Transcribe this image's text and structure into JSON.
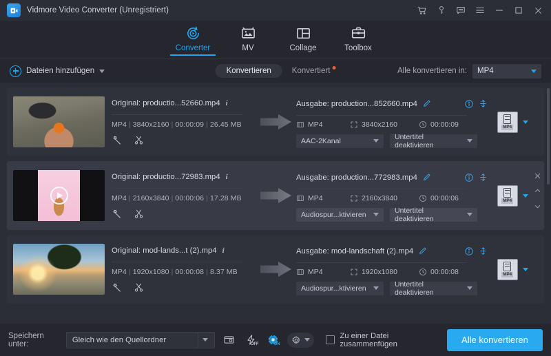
{
  "window": {
    "title": "Vidmore Video Converter (Unregistriert)",
    "controls": [
      {
        "name": "cart-icon",
        "glyph": "cart"
      },
      {
        "name": "key-icon",
        "glyph": "key"
      },
      {
        "name": "feedback-icon",
        "glyph": "message"
      },
      {
        "name": "menu-icon",
        "glyph": "hamburger"
      },
      {
        "name": "minimize-icon",
        "glyph": "minimize"
      },
      {
        "name": "maximize-icon",
        "glyph": "maximize"
      },
      {
        "name": "close-icon",
        "glyph": "close"
      }
    ]
  },
  "nav": {
    "tabs": [
      {
        "label": "Converter",
        "icon": "converter-icon",
        "active": true
      },
      {
        "label": "MV",
        "icon": "mv-icon",
        "active": false
      },
      {
        "label": "Collage",
        "icon": "collage-icon",
        "active": false
      },
      {
        "label": "Toolbox",
        "icon": "toolbox-icon",
        "active": false
      }
    ]
  },
  "actionbar": {
    "add_files_label": "Dateien hinzufügen",
    "tab_converting": "Konvertieren",
    "tab_converted": "Konvertiert",
    "convert_all_label": "Alle konvertieren in:",
    "convert_all_value": "MP4"
  },
  "labels": {
    "original_prefix": "Original:",
    "output_prefix": "Ausgabe:"
  },
  "files": [
    {
      "source_name": "Original: productio...52660.mp4",
      "format": "MP4",
      "resolution": "3840x2160",
      "duration": "00:00:09",
      "size": "26.45 MB",
      "output_name": "Ausgabe: production...852660.mp4",
      "out_format": "MP4",
      "out_resolution": "3840x2160",
      "out_duration": "00:00:09",
      "audio_track": "AAC-2Kanal",
      "subtitle": "Untertitel deaktivieren",
      "format_tag": "MP4",
      "thumb": "dog-with-ball",
      "hover": false
    },
    {
      "source_name": "Original: productio...72983.mp4",
      "format": "MP4",
      "resolution": "2160x3840",
      "duration": "00:00:06",
      "size": "17.28 MB",
      "output_name": "Ausgabe: production...772983.mp4",
      "out_format": "MP4",
      "out_resolution": "2160x3840",
      "out_duration": "00:00:06",
      "audio_track": "Audiospur...ktivieren",
      "subtitle": "Untertitel deaktivieren",
      "format_tag": "MP4",
      "thumb": "pink-dog-portrait",
      "hover": true
    },
    {
      "source_name": "Original: mod-lands...t (2).mp4",
      "format": "MP4",
      "resolution": "1920x1080",
      "duration": "00:00:08",
      "size": "8.37 MB",
      "output_name": "Ausgabe: mod-landschaft (2).mp4",
      "out_format": "MP4",
      "out_resolution": "1920x1080",
      "out_duration": "00:00:08",
      "audio_track": "Audiospur...ktivieren",
      "subtitle": "Untertitel deaktivieren",
      "format_tag": "MP4",
      "thumb": "sunset-palm-beach",
      "hover": false
    }
  ],
  "bottombar": {
    "save_to_label": "Speichern unter:",
    "save_path": "Gleich wie den Quellordner",
    "hw_off_tag": "OFF",
    "hw_on_tag": "ON",
    "merge_label": "Zu einer Datei zusammenfügen",
    "convert_button": "Alle konvertieren"
  },
  "colors": {
    "accent": "#1ea7f0",
    "convert_button_bg": "#29aaf0",
    "badge_dot": "#e8603c",
    "window_bg": "#25262e",
    "list_bg": "#2b2d37",
    "row_bg": "#2f313b",
    "row_hover_bg": "#383a45"
  }
}
